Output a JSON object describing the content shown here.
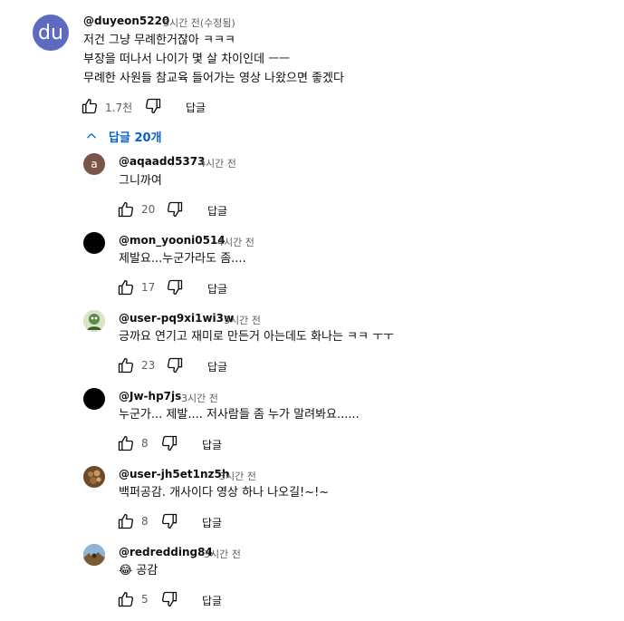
{
  "main_comment": {
    "avatar_text": "du",
    "avatar_color": "#5c6bc0",
    "handle": "@duyeon5220",
    "time": "5시간 전(수정됨)",
    "lines": [
      "저건 그냥 무례한거잖아 ㅋㅋㅋ",
      "부장을 떠나서 나이가 몇 살 차이인데 ㅡㅡ",
      "무례한 사원들 참교육 들어가는 영상 나왔으면 좋겠다"
    ],
    "likes": "1.7천",
    "reply_label": "답글"
  },
  "replies_toggle": {
    "label": "답글 20개",
    "icon": "chevron-up-icon",
    "color": "#065fd4"
  },
  "replies": [
    {
      "avatar": "a",
      "avatar_color": "#795548",
      "handle": "@aqaadd5373",
      "time": "4시간 전",
      "text": "그니까여",
      "likes": "20",
      "reply_label": "답글"
    },
    {
      "avatar": "",
      "avatar_color": "#000000",
      "handle": "@mon_yooni0514",
      "time": "4시간 전",
      "text": "제발요...누군가라도 좀....",
      "likes": "17",
      "reply_label": "답글"
    },
    {
      "avatar": "",
      "avatar_color": "#a8c49a",
      "handle": "@user-pq9xi1wi3w",
      "time": "3시간 전",
      "text": "긍까요 연기고 재미로 만든거 아는데도 화나는 ㅋㅋ ㅜㅜ",
      "likes": "23",
      "reply_label": "답글"
    },
    {
      "avatar": "",
      "avatar_color": "#000000",
      "handle": "@Jw-hp7js",
      "time": "3시간 전",
      "text": "누군가... 제발.... 저사람들 좀 누가 말려봐요......",
      "likes": "8",
      "reply_label": "답글"
    },
    {
      "avatar": "",
      "avatar_color": "#8d5b3a",
      "handle": "@user-jh5et1nz5h",
      "time": "3시간 전",
      "text": "백퍼공감. 개사이다 영상 하나 나오길!~!~",
      "likes": "8",
      "reply_label": "답글"
    },
    {
      "avatar": "",
      "avatar_color": "#7f9fb8",
      "handle": "@redredding84",
      "time": "3시간 전",
      "text": "😂 공감",
      "likes": "5",
      "reply_label": "답글"
    }
  ],
  "icons": {
    "like": "thumbs-up-icon",
    "dislike": "thumbs-down-icon"
  }
}
